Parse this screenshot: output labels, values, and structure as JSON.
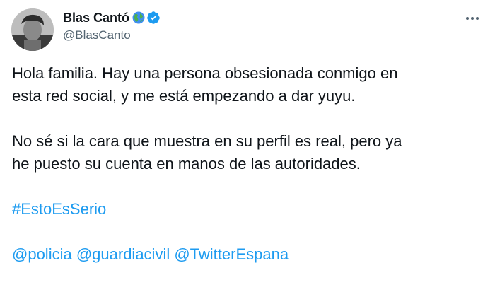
{
  "author": {
    "display_name": "Blas Cantó",
    "handle": "@BlasCanto",
    "badges": [
      "globe-emoji-icon",
      "verified-badge-icon"
    ]
  },
  "tweet": {
    "paragraph_1": "Hola familia. Hay una persona obsesionada conmigo en\nesta red social, y me está empezando a dar yuyu.",
    "paragraph_2": "No sé si la cara que muestra en su perfil es real, pero ya\nhe puesto su cuenta en manos de las autoridades.",
    "hashtag": "#EstoEsSerio",
    "mentions": [
      "@policia",
      "@guardiacivil",
      "@TwitterEspana"
    ]
  },
  "menu": {
    "icon": "more-options-icon"
  },
  "colors": {
    "link": "#1d9bf0",
    "text": "#0f1419",
    "secondary": "#536471",
    "verified": "#1d9bf0"
  }
}
